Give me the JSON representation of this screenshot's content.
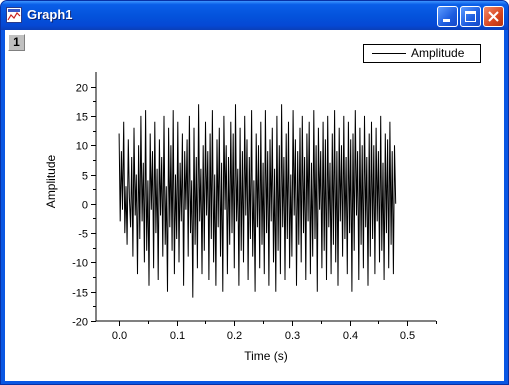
{
  "window": {
    "title": "Graph1",
    "layer_label": "1"
  },
  "icons": {
    "app": "graph-window-icon",
    "minimize": "minimize-icon",
    "maximize": "maximize-icon",
    "close": "close-icon"
  },
  "colors": {
    "titlebar": "#0453dc",
    "close_button": "#d8451f",
    "trace": "#000000"
  },
  "legend": {
    "label": "Amplitude"
  },
  "chart_data": {
    "type": "line",
    "title": "",
    "xlabel": "Time (s)",
    "ylabel": "Amplitude",
    "xlim": [
      -0.04,
      0.55
    ],
    "ylim": [
      -20,
      22.5
    ],
    "xticks": [
      "0.0",
      "0.1",
      "0.2",
      "0.3",
      "0.4",
      "0.5"
    ],
    "xtick_values": [
      0.0,
      0.1,
      0.2,
      0.3,
      0.4,
      0.5
    ],
    "yticks": [
      "-20",
      "-15",
      "-10",
      "-5",
      "0",
      "5",
      "10",
      "15",
      "20"
    ],
    "ytick_values": [
      -20,
      -15,
      -10,
      -5,
      0,
      5,
      10,
      15,
      20
    ],
    "grid": false,
    "legend_position": "top-right",
    "series": [
      {
        "name": "Amplitude",
        "x_start": 0.0,
        "x_step": 0.002,
        "y": [
          12,
          -3,
          9,
          -1,
          14,
          -5,
          3,
          -7,
          11,
          1,
          -4,
          8,
          -9,
          13,
          -2,
          5,
          -12,
          10,
          -6,
          15,
          -3,
          7,
          -10,
          16,
          -8,
          4,
          -14,
          12,
          -1,
          9,
          -11,
          14,
          -5,
          6,
          -13,
          11,
          -2,
          8,
          -9,
          15,
          -7,
          3,
          -15,
          13,
          -4,
          10,
          -8,
          16,
          -12,
          5,
          -6,
          14,
          -10,
          7,
          -3,
          12,
          -14,
          9,
          -1,
          11,
          -9,
          15,
          -5,
          4,
          -16,
          13,
          -7,
          8,
          -11,
          17,
          -3,
          6,
          -12,
          10,
          -8,
          14,
          -2,
          9,
          -13,
          12,
          -6,
          16,
          -10,
          5,
          -14,
          11,
          -4,
          13,
          -9,
          7,
          -15,
          15,
          -1,
          10,
          -12,
          8,
          -7,
          14,
          -5,
          12,
          -11,
          17,
          -3,
          6,
          -14,
          13,
          -8,
          9,
          -10,
          15,
          -2,
          11,
          -13,
          8,
          -6,
          16,
          -9,
          4,
          -15,
          12,
          -4,
          10,
          -11,
          14,
          -7,
          7,
          -12,
          16,
          -5,
          9,
          -14,
          11,
          -3,
          13,
          -10,
          6,
          -15,
          15,
          -8,
          10,
          -12,
          17,
          -4,
          8,
          -13,
          12,
          -6,
          14,
          -11,
          5,
          -9,
          16,
          -2,
          11,
          -14,
          9,
          -7,
          13,
          -10,
          15,
          -5,
          8,
          -13,
          12,
          -3,
          14,
          -12,
          7,
          -9,
          16,
          -6,
          10,
          -15,
          13,
          -1,
          9,
          -11,
          14,
          -8,
          11,
          -13,
          15,
          -4,
          7,
          -12,
          12,
          -7,
          16,
          -10,
          9,
          -14,
          13,
          -3,
          10,
          -9,
          15,
          -6,
          8,
          -12,
          14,
          -5,
          11,
          -15,
          12,
          -8,
          16,
          -2,
          9,
          -13,
          13,
          -7,
          10,
          -11,
          15,
          -4,
          8,
          -14,
          12,
          -9,
          14,
          -6,
          10,
          -12,
          13,
          -3,
          9,
          -10,
          15,
          -8,
          7,
          -13,
          12,
          -5,
          11,
          -11,
          14,
          -7,
          9,
          -12,
          10,
          0
        ]
      }
    ]
  }
}
